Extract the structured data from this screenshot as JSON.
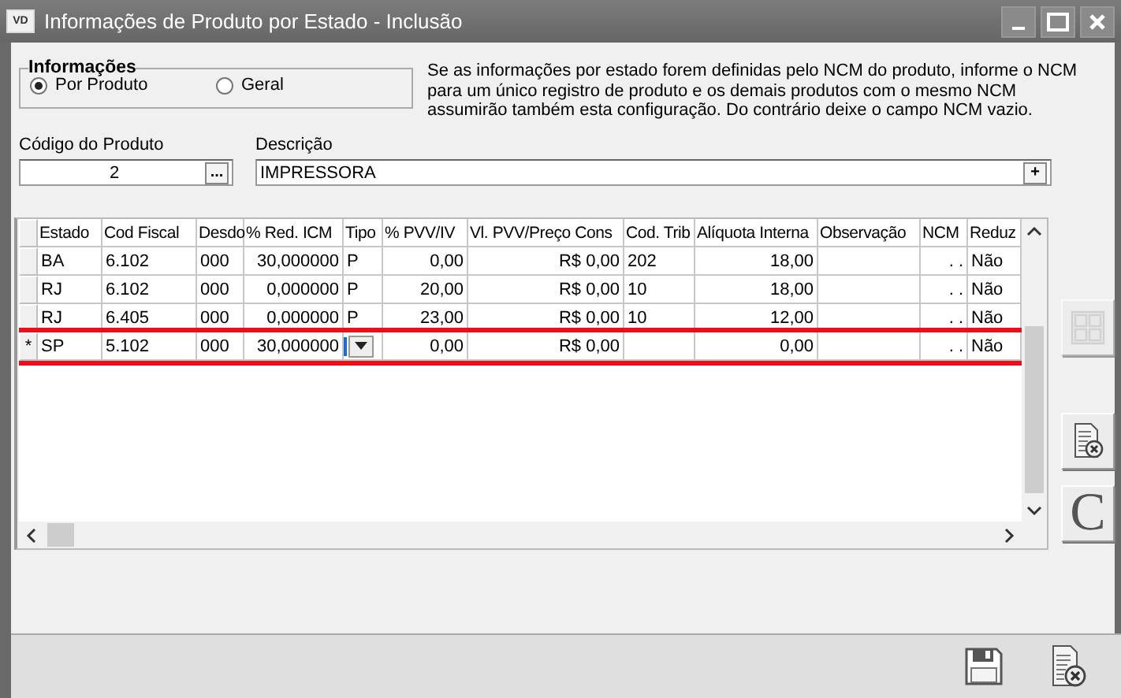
{
  "window": {
    "title": "Informações de Produto por Estado - Inclusão",
    "badge": "VD"
  },
  "info_group": {
    "title": "Informações",
    "options": [
      {
        "label": "Por Produto",
        "selected": true
      },
      {
        "label": "Geral",
        "selected": false
      }
    ]
  },
  "hint": "Se as informações por estado forem definidas pelo NCM do produto, informe o NCM\npara um único registro de produto e os demais produtos com o mesmo NCM\nassumirão também esta configuração. Do contrário deixe o campo NCM vazio.",
  "product_code": {
    "label": "Código do Produto",
    "value": "2",
    "button": "..."
  },
  "description": {
    "label": "Descrição",
    "value": "IMPRESSORA",
    "button": "+"
  },
  "grid": {
    "columns": [
      "Estado",
      "Cod Fiscal",
      "Desdo",
      "% Red. ICM",
      "Tipo",
      "% PVV/IV",
      "Vl. PVV/Preço Cons",
      "Cod. Trib",
      "Alíquota Interna",
      "Observação",
      "NCM",
      "Reduz"
    ],
    "rows": [
      {
        "current": false,
        "highlighted": false,
        "cells": [
          "BA",
          "6.102",
          "000",
          "30,000000",
          "P",
          "0,00",
          "R$ 0,00",
          "202",
          "18,00",
          "",
          ". .",
          "Não"
        ]
      },
      {
        "current": false,
        "highlighted": false,
        "cells": [
          "RJ",
          "6.102",
          "000",
          "0,000000",
          "P",
          "20,00",
          "R$ 0,00",
          "10",
          "18,00",
          "",
          ". .",
          "Não"
        ]
      },
      {
        "current": false,
        "highlighted": false,
        "cells": [
          "RJ",
          "6.405",
          "000",
          "0,000000",
          "P",
          "23,00",
          "R$ 0,00",
          "10",
          "12,00",
          "",
          ". .",
          "Não"
        ]
      },
      {
        "current": true,
        "highlighted": true,
        "marker": "*",
        "cells": [
          "SP",
          "5.102",
          "000",
          "30,000000",
          "",
          "0,00",
          "R$ 0,00",
          "",
          "0,00",
          "",
          ". .",
          "Não"
        ]
      }
    ]
  },
  "side_buttons": [
    {
      "kind": "grid",
      "disabled": true
    },
    {
      "kind": "delete",
      "disabled": false
    },
    {
      "kind": "letter",
      "label": "C",
      "disabled": false
    }
  ],
  "footer_buttons": [
    {
      "kind": "save"
    },
    {
      "kind": "cancel"
    }
  ]
}
